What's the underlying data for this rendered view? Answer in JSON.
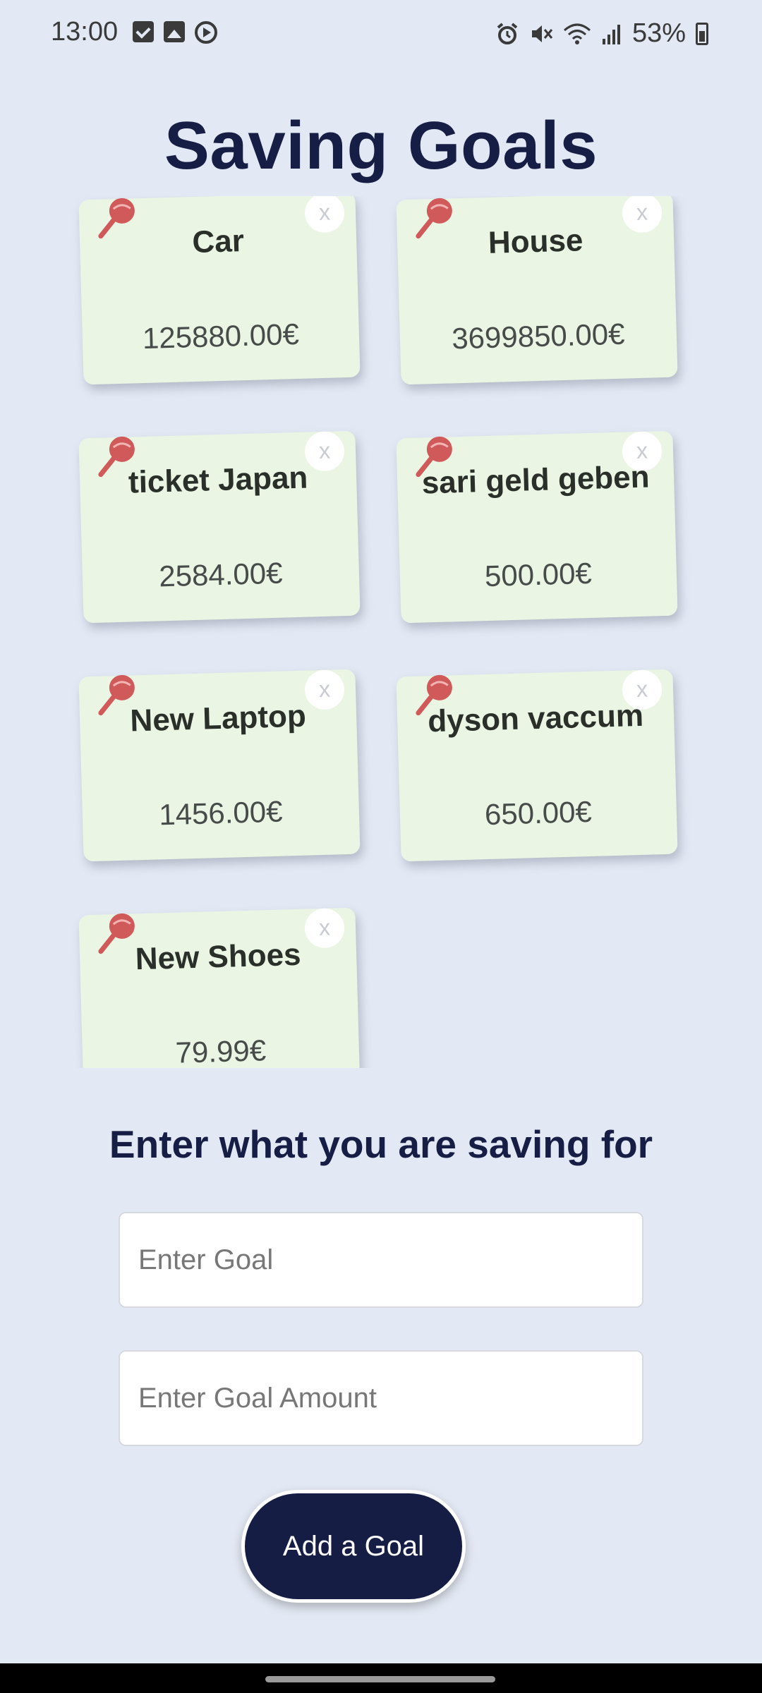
{
  "status_bar": {
    "time": "13:00",
    "battery": "53%",
    "left_icons": [
      "checkbox-notification-icon",
      "image-notification-icon",
      "play-notification-icon"
    ],
    "right_icons": [
      "alarm-icon",
      "mute-icon",
      "wifi-icon",
      "signal-icon",
      "battery-icon"
    ]
  },
  "page": {
    "title": "Saving Goals"
  },
  "goals": [
    {
      "name": "Car",
      "amount": "125880.00€"
    },
    {
      "name": "House",
      "amount": "3699850.00€"
    },
    {
      "name": "ticket Japan",
      "amount": "2584.00€"
    },
    {
      "name": "sari geld geben",
      "amount": "500.00€"
    },
    {
      "name": "New Laptop",
      "amount": "1456.00€"
    },
    {
      "name": "dyson vaccum",
      "amount": "650.00€"
    },
    {
      "name": "New Shoes",
      "amount": "79.99€"
    }
  ],
  "card": {
    "delete_label": "x",
    "pin_icon": "pushpin-icon",
    "background": "#eaf5e4"
  },
  "form": {
    "heading": "Enter what you are saving for",
    "goal_placeholder": "Enter Goal",
    "amount_placeholder": "Enter Goal Amount",
    "button_label": "Add a Goal"
  },
  "colors": {
    "background": "#e3e9f4",
    "primary": "#151d45",
    "pin": "#d05a5a"
  }
}
